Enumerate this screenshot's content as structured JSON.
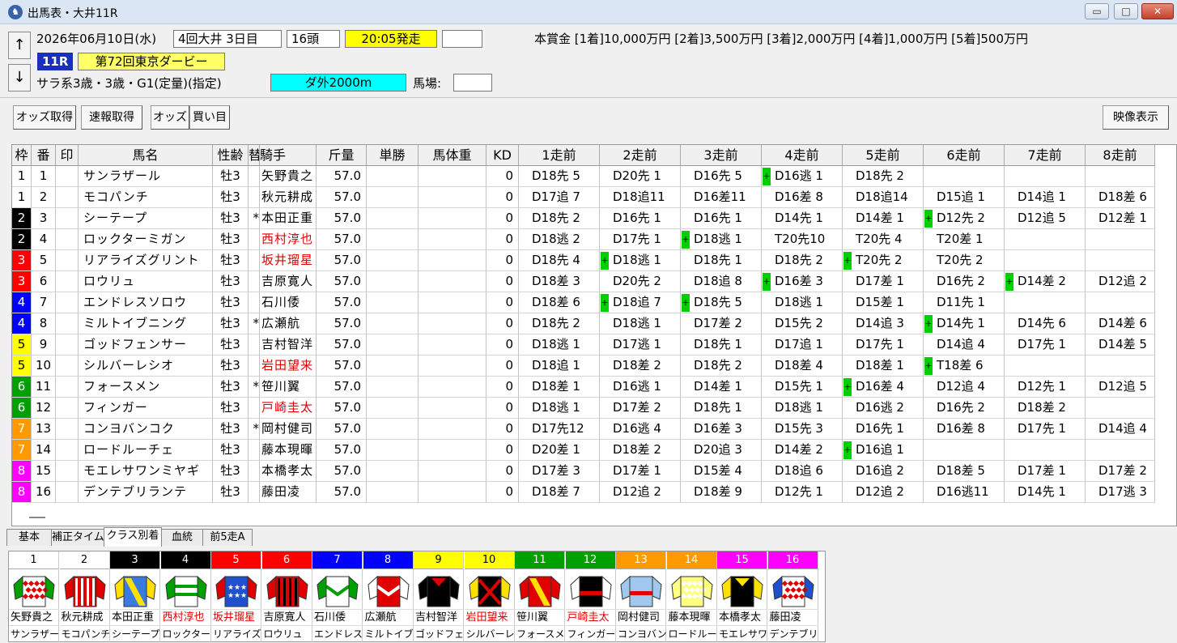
{
  "window": {
    "title": "出馬表・大井11R",
    "app_icon": "horse-rider-icon",
    "minimize": "▭",
    "maximize": "□",
    "close": "✕"
  },
  "race": {
    "date": "2026年06月10日(水)",
    "meeting": "4回大井 3日目",
    "runners": "16頭",
    "post_time": "20:05発走",
    "blank": "",
    "race_no": "11R",
    "race_name": "第72回東京ダービー",
    "conditions": "サラ系3歳・3歳・G1(定量)(指定)",
    "course": "ダ外2000m",
    "going_label": "馬場:",
    "going": "",
    "prize": "本賞金 [1着]10,000万円 [2着]3,500万円 [3着]2,000万円 [4着]1,000万円 [5着]500万円",
    "up_arrow": "↑",
    "down_arrow": "↓"
  },
  "toolbar": {
    "odds_get": "オッズ取得",
    "quick_get": "速報取得",
    "odds": "オッズ",
    "buy": "買い目",
    "video": "映像表示"
  },
  "columns": [
    "枠",
    "番",
    "印",
    "馬名",
    "性齢",
    "替",
    "騎手",
    "斤量",
    "単勝",
    "馬体重",
    "KD",
    "1走前",
    "2走前",
    "3走前",
    "4走前",
    "5走前",
    "6走前",
    "7走前",
    "8走前"
  ],
  "colors": {
    "frame": [
      "#ffffff",
      "#000000",
      "#ff0000",
      "#0000ff",
      "#ffff00",
      "#00a000",
      "#ff9900",
      "#ff00ff"
    ],
    "frame_text": [
      "#000000",
      "#ffffff",
      "#ffffff",
      "#ffffff",
      "#000000",
      "#ffffff",
      "#ffffff",
      "#ffffff"
    ],
    "plus": "#00d000",
    "red_text": "#e00000"
  },
  "horses": [
    {
      "waku": "1",
      "num": "1",
      "mark": "",
      "name": "サンラザール",
      "sex_age": "牡3",
      "change": "",
      "jockey": "矢野貴之",
      "red": false,
      "weight": "57.0",
      "odds": "",
      "body": "",
      "kd": "0",
      "past": [
        "D18先 5",
        "D20先 1",
        "D16先 5",
        "D16逃 1",
        "D18先 2",
        "",
        "",
        ""
      ],
      "plus": [
        false,
        false,
        false,
        true,
        false,
        false,
        false,
        false
      ]
    },
    {
      "waku": "1",
      "num": "2",
      "mark": "",
      "name": "モコパンチ",
      "sex_age": "牡3",
      "change": "",
      "jockey": "秋元耕成",
      "red": false,
      "weight": "57.0",
      "odds": "",
      "body": "",
      "kd": "0",
      "past": [
        "D17追 7",
        "D18追11",
        "D16差11",
        "D16差 8",
        "D18追14",
        "D15追 1",
        "D14追 1",
        "D18差 6"
      ],
      "plus": [
        false,
        false,
        false,
        false,
        false,
        false,
        false,
        false
      ]
    },
    {
      "waku": "2",
      "num": "3",
      "mark": "",
      "name": "シーテープ",
      "sex_age": "牡3",
      "change": "*",
      "jockey": "本田正重",
      "red": false,
      "weight": "57.0",
      "odds": "",
      "body": "",
      "kd": "0",
      "past": [
        "D18先 2",
        "D16先 1",
        "D16先 1",
        "D14先 1",
        "D14差 1",
        "D12先 2",
        "D12追 5",
        "D12差 1"
      ],
      "plus": [
        false,
        false,
        false,
        false,
        false,
        true,
        false,
        false
      ]
    },
    {
      "waku": "2",
      "num": "4",
      "mark": "",
      "name": "ロックターミガン",
      "sex_age": "牡3",
      "change": "",
      "jockey": "西村淳也",
      "red": true,
      "weight": "57.0",
      "odds": "",
      "body": "",
      "kd": "0",
      "past": [
        "D18逃 2",
        "D17先 1",
        "D18逃 1",
        "T20先10",
        "T20先 4",
        "T20差 1",
        "",
        ""
      ],
      "plus": [
        false,
        false,
        true,
        false,
        false,
        false,
        false,
        false
      ]
    },
    {
      "waku": "3",
      "num": "5",
      "mark": "",
      "name": "リアライズグリント",
      "sex_age": "牡3",
      "change": "",
      "jockey": "坂井瑠星",
      "red": true,
      "weight": "57.0",
      "odds": "",
      "body": "",
      "kd": "0",
      "past": [
        "D18先 4",
        "D18逃 1",
        "D18先 1",
        "D18先 2",
        "T20先 2",
        "T20先 2",
        "",
        ""
      ],
      "plus": [
        false,
        true,
        false,
        false,
        true,
        false,
        false,
        false
      ]
    },
    {
      "waku": "3",
      "num": "6",
      "mark": "",
      "name": "ロウリュ",
      "sex_age": "牡3",
      "change": "",
      "jockey": "吉原寛人",
      "red": false,
      "weight": "57.0",
      "odds": "",
      "body": "",
      "kd": "0",
      "past": [
        "D18差 3",
        "D20先 2",
        "D18追 8",
        "D16差 3",
        "D17差 1",
        "D16先 2",
        "D14差 2",
        "D12追 2"
      ],
      "plus": [
        false,
        false,
        false,
        true,
        false,
        false,
        true,
        false
      ]
    },
    {
      "waku": "4",
      "num": "7",
      "mark": "",
      "name": "エンドレスソロウ",
      "sex_age": "牡3",
      "change": "",
      "jockey": "石川倭",
      "red": false,
      "weight": "57.0",
      "odds": "",
      "body": "",
      "kd": "0",
      "past": [
        "D18差 6",
        "D18追 7",
        "D18先 5",
        "D18逃 1",
        "D15差 1",
        "D11先 1",
        "",
        ""
      ],
      "plus": [
        false,
        true,
        true,
        false,
        false,
        false,
        false,
        false
      ]
    },
    {
      "waku": "4",
      "num": "8",
      "mark": "",
      "name": "ミルトイブニング",
      "sex_age": "牡3",
      "change": "*",
      "jockey": "広瀬航",
      "red": false,
      "weight": "57.0",
      "odds": "",
      "body": "",
      "kd": "0",
      "past": [
        "D18先 2",
        "D18逃 1",
        "D17差 2",
        "D15先 2",
        "D14追 3",
        "D14先 1",
        "D14先 6",
        "D14差 6"
      ],
      "plus": [
        false,
        false,
        false,
        false,
        false,
        true,
        false,
        false
      ]
    },
    {
      "waku": "5",
      "num": "9",
      "mark": "",
      "name": "ゴッドフェンサー",
      "sex_age": "牡3",
      "change": "",
      "jockey": "吉村智洋",
      "red": false,
      "weight": "57.0",
      "odds": "",
      "body": "",
      "kd": "0",
      "past": [
        "D18逃 1",
        "D17逃 1",
        "D18先 1",
        "D17追 1",
        "D17先 1",
        "D14追 4",
        "D17先 1",
        "D14差 5"
      ],
      "plus": [
        false,
        false,
        false,
        false,
        false,
        false,
        false,
        false
      ]
    },
    {
      "waku": "5",
      "num": "10",
      "mark": "",
      "name": "シルバーレシオ",
      "sex_age": "牡3",
      "change": "",
      "jockey": "岩田望来",
      "red": true,
      "weight": "57.0",
      "odds": "",
      "body": "",
      "kd": "0",
      "past": [
        "D18追 1",
        "D18差 2",
        "D18先 2",
        "D18差 4",
        "D18差 1",
        "T18差 6",
        "",
        ""
      ],
      "plus": [
        false,
        false,
        false,
        false,
        false,
        true,
        false,
        false
      ]
    },
    {
      "waku": "6",
      "num": "11",
      "mark": "",
      "name": "フォースメン",
      "sex_age": "牡3",
      "change": "*",
      "jockey": "笹川翼",
      "red": false,
      "weight": "57.0",
      "odds": "",
      "body": "",
      "kd": "0",
      "past": [
        "D18差 1",
        "D16逃 1",
        "D14差 1",
        "D15先 1",
        "D16差 4",
        "D12追 4",
        "D12先 1",
        "D12追 5"
      ],
      "plus": [
        false,
        false,
        false,
        false,
        true,
        false,
        false,
        false
      ]
    },
    {
      "waku": "6",
      "num": "12",
      "mark": "",
      "name": "フィンガー",
      "sex_age": "牡3",
      "change": "",
      "jockey": "戸崎圭太",
      "red": true,
      "weight": "57.0",
      "odds": "",
      "body": "",
      "kd": "0",
      "past": [
        "D18逃 1",
        "D17差 2",
        "D18先 1",
        "D18逃 1",
        "D16逃 2",
        "D16先 2",
        "D18差 2",
        ""
      ],
      "plus": [
        false,
        false,
        false,
        false,
        false,
        false,
        false,
        false
      ]
    },
    {
      "waku": "7",
      "num": "13",
      "mark": "",
      "name": "コンヨバンコク",
      "sex_age": "牡3",
      "change": "*",
      "jockey": "岡村健司",
      "red": false,
      "weight": "57.0",
      "odds": "",
      "body": "",
      "kd": "0",
      "past": [
        "D17先12",
        "D16逃 4",
        "D16差 3",
        "D15先 3",
        "D16先 1",
        "D16差 8",
        "D17先 1",
        "D14追 4"
      ],
      "plus": [
        false,
        false,
        false,
        false,
        false,
        false,
        false,
        false
      ]
    },
    {
      "waku": "7",
      "num": "14",
      "mark": "",
      "name": "ロードルーチェ",
      "sex_age": "牡3",
      "change": "",
      "jockey": "藤本現暉",
      "red": false,
      "weight": "57.0",
      "odds": "",
      "body": "",
      "kd": "0",
      "past": [
        "D20差 1",
        "D18差 2",
        "D20追 3",
        "D14差 2",
        "D16追 1",
        "",
        "",
        ""
      ],
      "plus": [
        false,
        false,
        false,
        false,
        true,
        false,
        false,
        false
      ]
    },
    {
      "waku": "8",
      "num": "15",
      "mark": "",
      "name": "モエレサワンミヤギ",
      "sex_age": "牡3",
      "change": "",
      "jockey": "本橋孝太",
      "red": false,
      "weight": "57.0",
      "odds": "",
      "body": "",
      "kd": "0",
      "past": [
        "D17差 3",
        "D17差 1",
        "D15差 4",
        "D18追 6",
        "D16追 2",
        "D18差 5",
        "D17差 1",
        "D17差 2"
      ],
      "plus": [
        false,
        false,
        false,
        false,
        false,
        false,
        false,
        false
      ]
    },
    {
      "waku": "8",
      "num": "16",
      "mark": "",
      "name": "デンテブリランテ",
      "sex_age": "牡3",
      "change": "",
      "jockey": "藤田凌",
      "red": false,
      "weight": "57.0",
      "odds": "",
      "body": "",
      "kd": "0",
      "past": [
        "D18差 7",
        "D12追 2",
        "D18差 9",
        "D12先 1",
        "D12追 2",
        "D16逃11",
        "D14先 1",
        "D17逃 3"
      ],
      "plus": [
        false,
        false,
        false,
        false,
        false,
        false,
        false,
        false
      ]
    }
  ],
  "tabs": [
    "基本",
    "補正タイム",
    "クラス別着",
    "血統",
    "前5走A"
  ],
  "active_tab": 2,
  "silks": [
    {
      "num": "1",
      "jockey": "矢野貴之",
      "horse": "サンラザール",
      "bg": "#ffffff",
      "fg": "#000000",
      "red": false
    },
    {
      "num": "2",
      "jockey": "秋元耕成",
      "horse": "モコパンチ",
      "bg": "#ffffff",
      "fg": "#000000",
      "red": false
    },
    {
      "num": "3",
      "jockey": "本田正重",
      "horse": "シーテープ",
      "bg": "#000000",
      "fg": "#ffffff",
      "red": false
    },
    {
      "num": "4",
      "jockey": "西村淳也",
      "horse": "ロックターミガン",
      "bg": "#000000",
      "fg": "#ffffff",
      "red": true
    },
    {
      "num": "5",
      "jockey": "坂井瑠星",
      "horse": "リアライズグリント",
      "bg": "#ff0000",
      "fg": "#ffffff",
      "red": true
    },
    {
      "num": "6",
      "jockey": "吉原寛人",
      "horse": "ロウリュ",
      "bg": "#ff0000",
      "fg": "#ffffff",
      "red": false
    },
    {
      "num": "7",
      "jockey": "石川倭",
      "horse": "エンドレスソロウ",
      "bg": "#0000ff",
      "fg": "#ffffff",
      "red": false
    },
    {
      "num": "8",
      "jockey": "広瀬航",
      "horse": "ミルトイブニング",
      "bg": "#0000ff",
      "fg": "#ffffff",
      "red": false
    },
    {
      "num": "9",
      "jockey": "吉村智洋",
      "horse": "ゴッドフェンサー",
      "bg": "#ffff00",
      "fg": "#000000",
      "red": false
    },
    {
      "num": "10",
      "jockey": "岩田望来",
      "horse": "シルバーレシオ",
      "bg": "#ffff00",
      "fg": "#000000",
      "red": true
    },
    {
      "num": "11",
      "jockey": "笹川翼",
      "horse": "フォースメン",
      "bg": "#00a000",
      "fg": "#ffffff",
      "red": false
    },
    {
      "num": "12",
      "jockey": "戸崎圭太",
      "horse": "フィンガー",
      "bg": "#00a000",
      "fg": "#ffffff",
      "red": true
    },
    {
      "num": "13",
      "jockey": "岡村健司",
      "horse": "コンヨバンコク",
      "bg": "#ff9900",
      "fg": "#ffffff",
      "red": false
    },
    {
      "num": "14",
      "jockey": "藤本現暉",
      "horse": "ロードルーチェ",
      "bg": "#ff9900",
      "fg": "#ffffff",
      "red": false
    },
    {
      "num": "15",
      "jockey": "本橋孝太",
      "horse": "モエレサワンミヤギ",
      "bg": "#ff00ff",
      "fg": "#ffffff",
      "red": false
    },
    {
      "num": "16",
      "jockey": "藤田凌",
      "horse": "デンテブリランテ",
      "bg": "#ff00ff",
      "fg": "#ffffff",
      "red": false
    }
  ],
  "silk_patterns": [
    {
      "body": "#ffffff",
      "motif": "diamonds",
      "accent": "#e00000",
      "sleeve": "#00a000"
    },
    {
      "body": "#e00000",
      "motif": "stripes",
      "accent": "#ffffff",
      "sleeve": "#e00000"
    },
    {
      "body": "#3a7be0",
      "motif": "sash",
      "accent": "#ffe000",
      "sleeve": "#ffe000"
    },
    {
      "body": "#ffffff",
      "motif": "hoops",
      "accent": "#00a000",
      "sleeve": "#00a000"
    },
    {
      "body": "#1e50d0",
      "motif": "stars",
      "accent": "#ffffff",
      "sleeve": "#e00000"
    },
    {
      "body": "#e00000",
      "motif": "stripes",
      "accent": "#000000",
      "sleeve": "#e00000"
    },
    {
      "body": "#ffffff",
      "motif": "chevron",
      "accent": "#00a000",
      "sleeve": "#00a000"
    },
    {
      "body": "#e00000",
      "motif": "chevron",
      "accent": "#ffffff",
      "sleeve": "#ffffff"
    },
    {
      "body": "#000000",
      "motif": "collar",
      "accent": "#e00000",
      "sleeve": "#000000"
    },
    {
      "body": "#000000",
      "motif": "cross",
      "accent": "#e00000",
      "sleeve": "#ffe000"
    },
    {
      "body": "#e00000",
      "motif": "sash",
      "accent": "#ffe000",
      "sleeve": "#e00000"
    },
    {
      "body": "#000000",
      "motif": "hoop",
      "accent": "#e00000",
      "sleeve": "#ffffff"
    },
    {
      "body": "#a0c8ee",
      "motif": "hoop",
      "accent": "#e00000",
      "sleeve": "#a0c8ee"
    },
    {
      "body": "#ffff80",
      "motif": "diamonds",
      "accent": "#ffffff",
      "sleeve": "#ffff80"
    },
    {
      "body": "#000000",
      "motif": "collar",
      "accent": "#ffe000",
      "sleeve": "#ffe000"
    },
    {
      "body": "#ffffff",
      "motif": "diamonds",
      "accent": "#e00000",
      "sleeve": "#1e50d0"
    }
  ]
}
